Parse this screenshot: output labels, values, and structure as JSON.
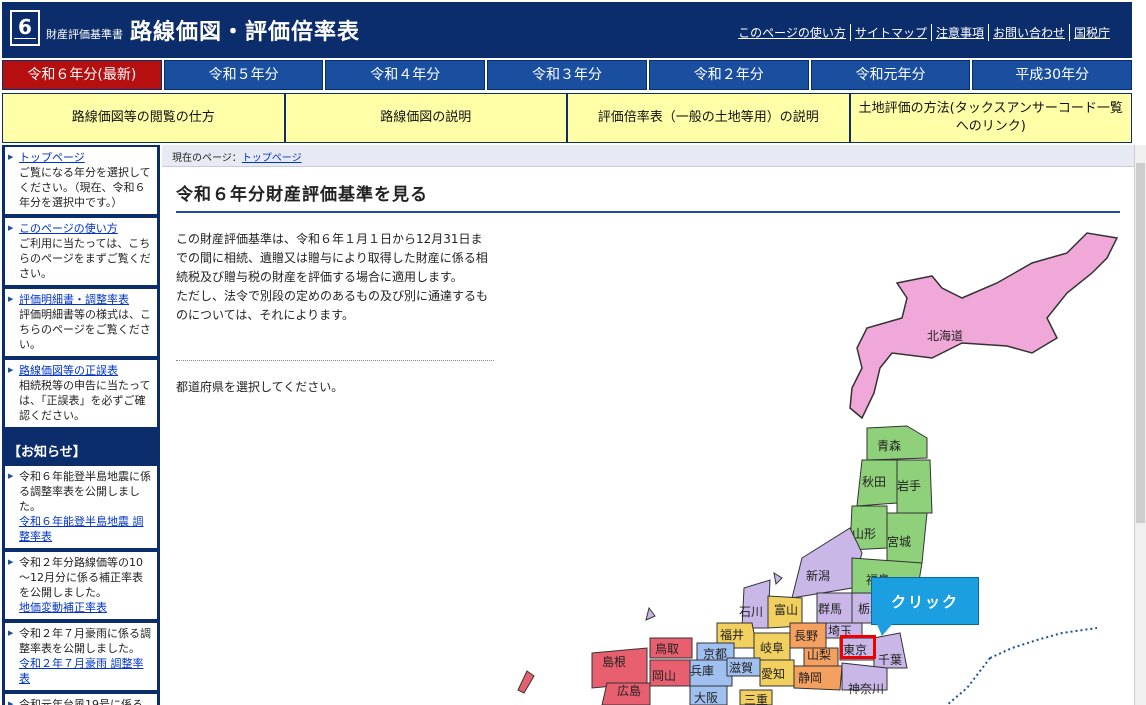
{
  "header": {
    "logo_number": "6",
    "series_name": "財産評価基準書",
    "site_title": "路線価図・評価倍率表",
    "links": [
      "このページの使い方",
      "サイトマップ",
      "注意事項",
      "お問い合わせ",
      "国税庁"
    ]
  },
  "year_tabs": [
    "令和６年分(最新)",
    "令和５年分",
    "令和４年分",
    "令和３年分",
    "令和２年分",
    "令和元年分",
    "平成30年分"
  ],
  "sub_tabs": [
    "路線価図等の閲覧の仕方",
    "路線価図の説明",
    "評価倍率表（一般の土地等用）の説明",
    "土地評価の方法(タックスアンサーコード一覧へのリンク)"
  ],
  "sidebar": {
    "items": [
      {
        "link": "トップページ",
        "text": "ご覧になる年分を選択してください。（現在、令和６年分を選択中です。）"
      },
      {
        "link": "このページの使い方",
        "text": "ご利用に当たっては、こちらのページをまずご覧ください。"
      },
      {
        "link": "評価明細書・調整率表",
        "text": "評価明細書等の様式は、こちらのページをご覧ください。"
      },
      {
        "link": "路線価図等の正誤表",
        "text": "相続税等の申告に当たっては、「正誤表」を必ずご確認ください。"
      }
    ],
    "notice_heading": "【お知らせ】",
    "notices": [
      {
        "text": "令和６年能登半島地震に係る調整率表を公開しました。",
        "link": "令和６年能登半島地震 調整率表"
      },
      {
        "text": "令和２年分路線価等の10～12月分に係る補正率表を公開しました。",
        "link": "地価変動補正率表"
      },
      {
        "text": "令和２年７月豪雨に係る調整率表を公開しました。",
        "link": "令和２年７月豪雨 調整率表"
      },
      {
        "text": "令和元年台風19号に係る",
        "link": ""
      }
    ]
  },
  "breadcrumb": {
    "prefix": "現在のページ：",
    "link": "トップページ"
  },
  "main": {
    "heading": "令和６年分財産評価基準を見る",
    "intro_1": "この財産評価基準は、令和６年１月１日から12月31日までの間に相続、遺贈又は贈与により取得した財産に係る相続税及び贈与税の財産を評価する場合に適用します。",
    "intro_2": "ただし、法令で別段の定めのあるもの及び別に通達するものについては、それによります。",
    "select_prompt": "都道府県を選択してください。"
  },
  "map": {
    "prefectures": [
      "北海道",
      "青森",
      "秋田",
      "岩手",
      "山形",
      "宮城",
      "新潟",
      "福島",
      "石川",
      "富山",
      "群馬",
      "栃木",
      "福井",
      "長野",
      "埼玉",
      "岐阜",
      "山梨",
      "東京",
      "千葉",
      "鳥取",
      "京都",
      "島根",
      "兵庫",
      "滋賀",
      "愛知",
      "静岡",
      "神奈川",
      "岡山",
      "広島",
      "大阪",
      "三重"
    ],
    "callout": "クリック",
    "highlighted": "東京"
  },
  "colors": {
    "header": "#0c2d6b",
    "active_tab": "#b50f0f",
    "tab": "#1a4fa0",
    "subtab": "#ffffa8",
    "hokkaido": "#f0a8d8",
    "tohoku": "#8fd07a",
    "kanto": "#c9b7e8",
    "callout": "#1b9fe0"
  }
}
